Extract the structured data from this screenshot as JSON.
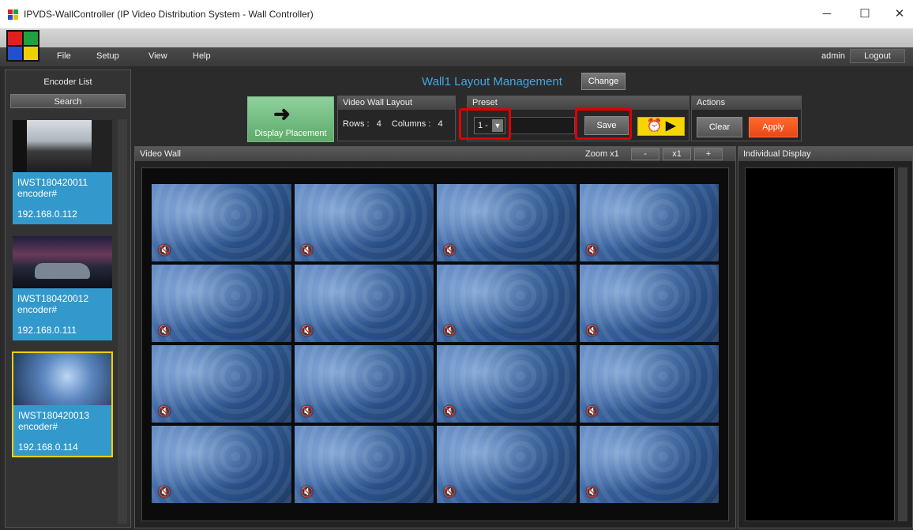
{
  "window": {
    "title": "IPVDS-WallController (IP Video Distribution System - Wall Controller)",
    "minimize_glyph": "─",
    "maximize_glyph": "☐",
    "close_glyph": "✕"
  },
  "menu": {
    "items": [
      "File",
      "Setup",
      "View",
      "Help"
    ],
    "user": "admin",
    "logout_label": "Logout"
  },
  "encoder_panel": {
    "title": "Encoder List",
    "search_label": "Search",
    "encoders": [
      {
        "name": "IWST180420011",
        "type": "encoder#",
        "ip": "192.168.0.112"
      },
      {
        "name": "IWST180420012",
        "type": "encoder#",
        "ip": "192.168.0.111"
      },
      {
        "name": "IWST180420013",
        "type": "encoder#",
        "ip": "192.168.0.114"
      }
    ]
  },
  "wall": {
    "title": "Wall1 Layout Management",
    "change_label": "Change"
  },
  "toolbar": {
    "display_placement_label": "Display Placement",
    "layout_group_title": "Video Wall Layout",
    "rows_label": "Rows :",
    "rows_value": "4",
    "columns_label": "Columns :",
    "columns_value": "4",
    "preset_group_title": "Preset",
    "preset_value": "1 -",
    "save_label": "Save",
    "schedule_glyph": "⏰ ▶",
    "actions_group_title": "Actions",
    "clear_label": "Clear",
    "apply_label": "Apply"
  },
  "video_wall": {
    "title": "Video Wall",
    "zoom_label": "Zoom x1",
    "zoom_minus": "-",
    "zoom_reset": "x1",
    "zoom_plus": "+",
    "mute_glyph": "🔇"
  },
  "individual_display": {
    "title": "Individual Display"
  },
  "colors": {
    "accent_blue": "#3ea8e6",
    "encoder_card": "#3399cc",
    "selected_border": "#f0d000",
    "apply_orange": "#ff6a2a",
    "placement_green": "#6fb97c",
    "highlight_red": "#e00000"
  }
}
